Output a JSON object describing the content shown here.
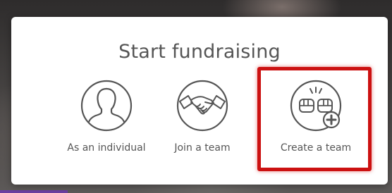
{
  "modal": {
    "title": "Start fundraising",
    "options": [
      {
        "label": "As an individual",
        "icon": "person-icon"
      },
      {
        "label": "Join a team",
        "icon": "handshake-icon"
      },
      {
        "label": "Create a team",
        "icon": "fist-bump-plus-icon",
        "highlighted": true
      }
    ]
  },
  "colors": {
    "icon_stroke": "#555555",
    "text": "#555555",
    "highlight": "#cc1111",
    "modal_bg": "#ffffff"
  }
}
